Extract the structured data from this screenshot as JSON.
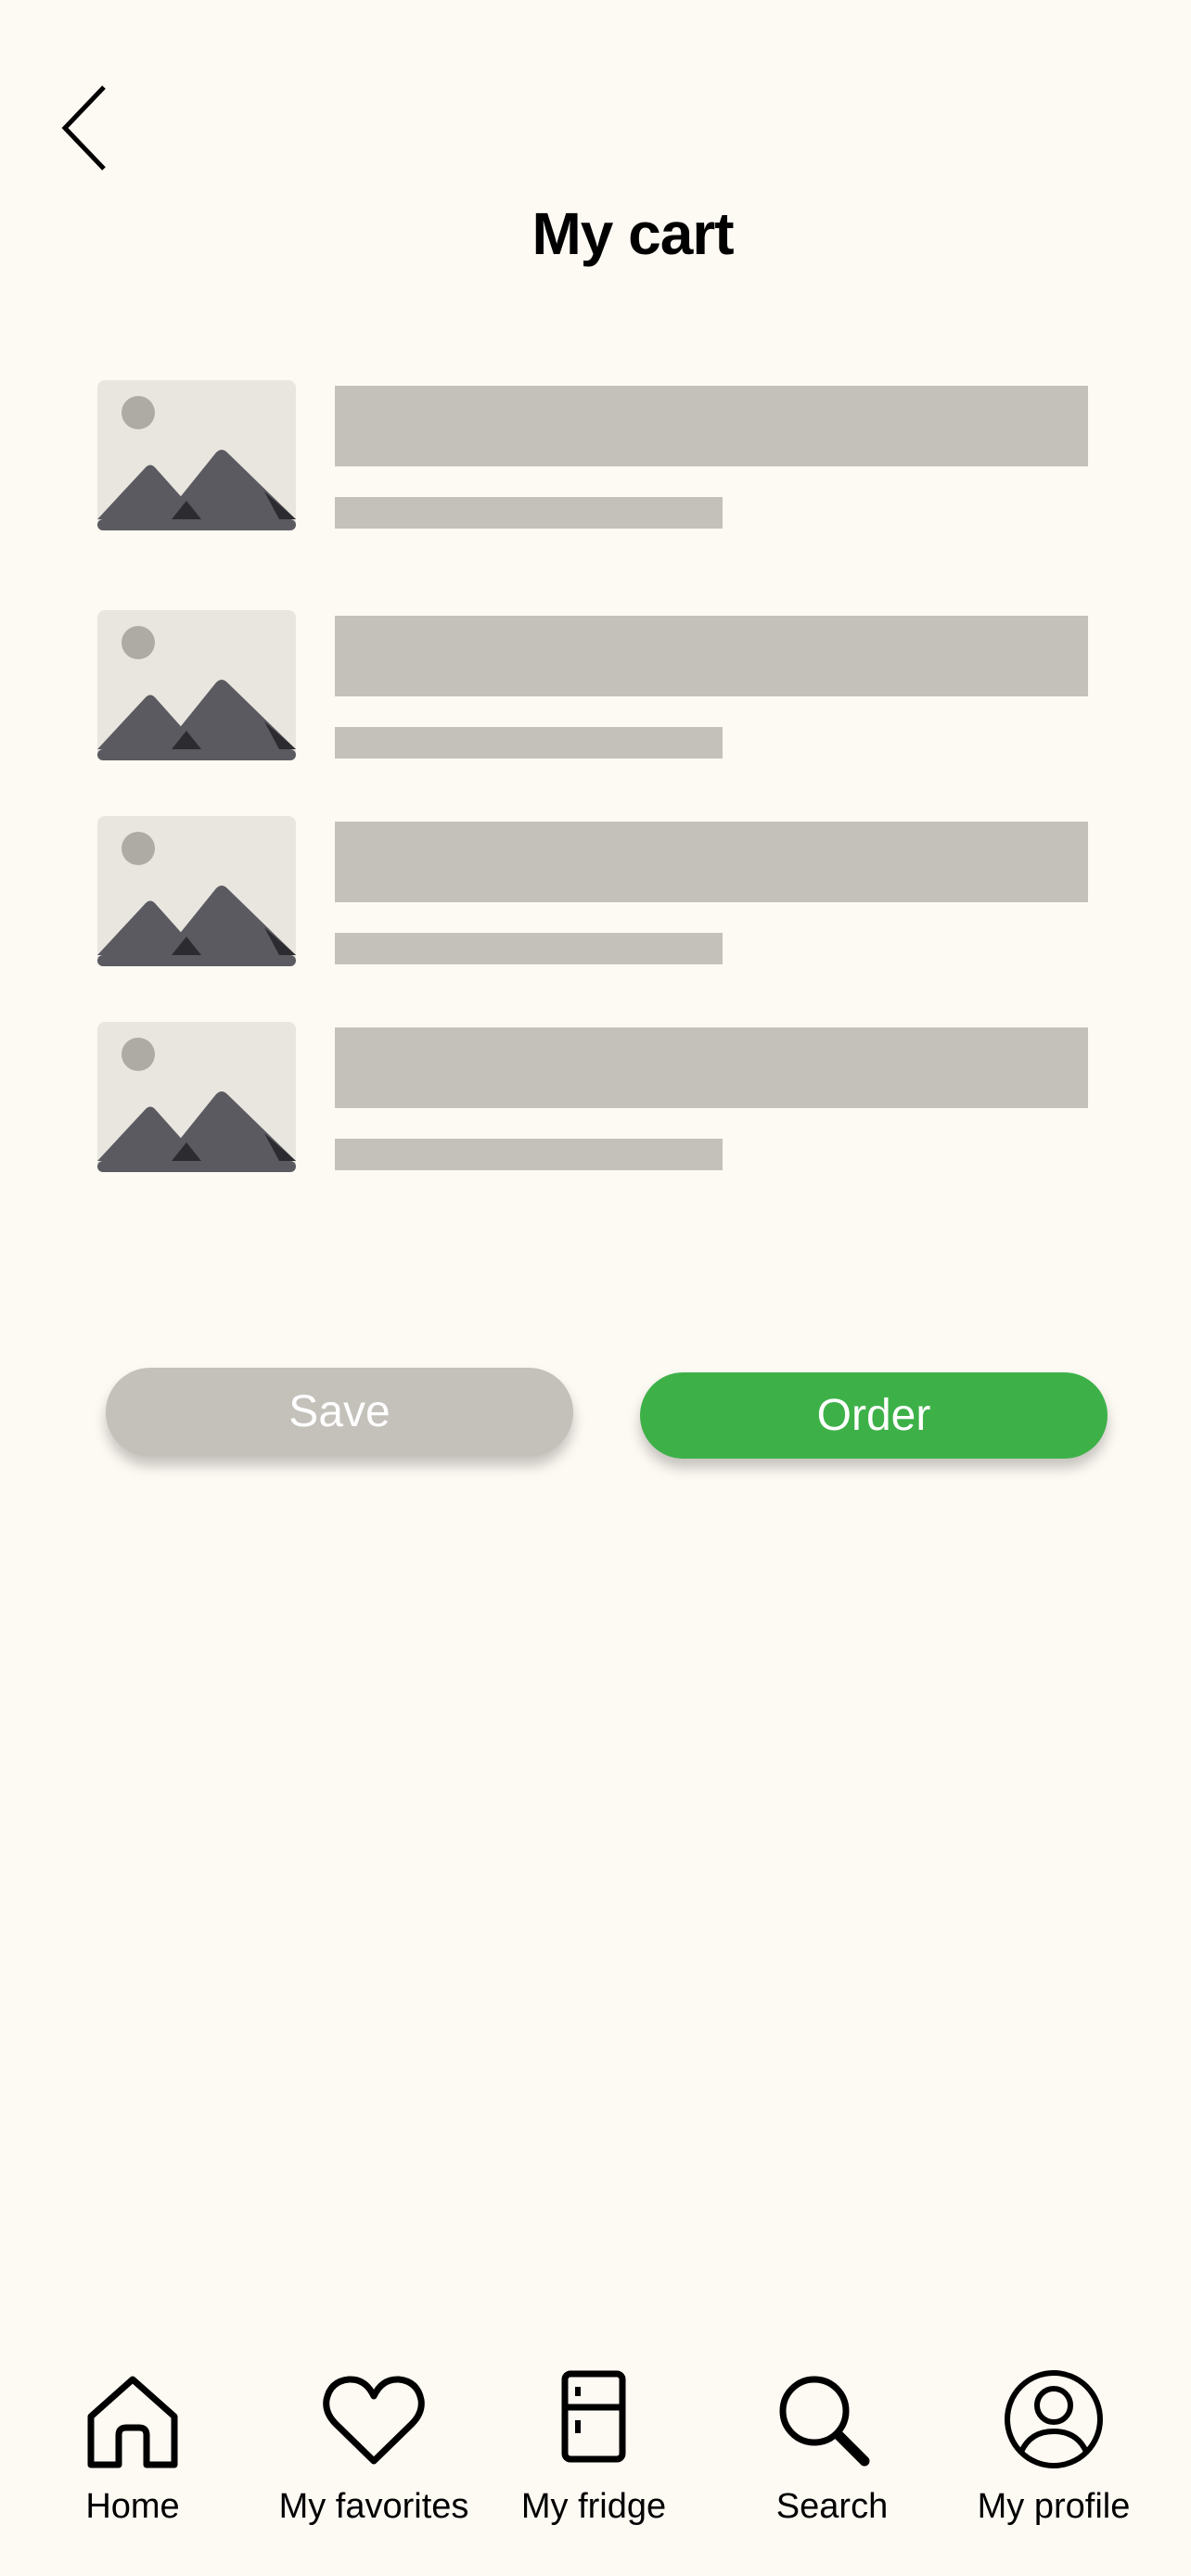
{
  "header": {
    "title": "My cart",
    "back_icon": "chevron-left-icon"
  },
  "cart": {
    "items": [
      {
        "image": "image-placeholder-icon"
      },
      {
        "image": "image-placeholder-icon"
      },
      {
        "image": "image-placeholder-icon"
      },
      {
        "image": "image-placeholder-icon"
      }
    ]
  },
  "actions": {
    "save_label": "Save",
    "order_label": "Order"
  },
  "colors": {
    "background": "#fdf9f3",
    "placeholder": "#c4c1bb",
    "accent": "#3db148"
  },
  "tab_bar": {
    "tabs": [
      {
        "label": "Home",
        "icon": "home-icon"
      },
      {
        "label": "My favorites",
        "icon": "heart-icon"
      },
      {
        "label": "My fridge",
        "icon": "fridge-icon"
      },
      {
        "label": "Search",
        "icon": "search-icon"
      },
      {
        "label": "My profile",
        "icon": "user-icon"
      }
    ]
  }
}
